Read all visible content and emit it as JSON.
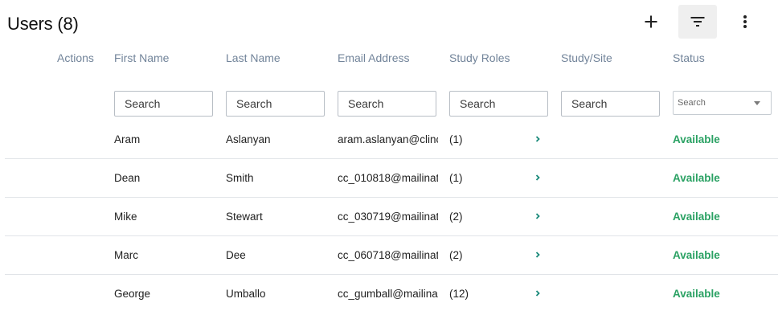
{
  "page": {
    "title": "Users (8)"
  },
  "toolbar": {
    "add_icon": "plus-icon",
    "filter_icon": "filter-list-icon",
    "more_icon": "more-vertical-icon"
  },
  "columns": {
    "actions": "Actions",
    "first_name": "First Name",
    "last_name": "Last Name",
    "email": "Email Address",
    "study_roles": "Study Roles",
    "study_site": "Study/Site",
    "status": "Status"
  },
  "filters": {
    "first_name_placeholder": "Search",
    "last_name_placeholder": "Search",
    "email_placeholder": "Search",
    "study_roles_placeholder": "Search",
    "study_site_placeholder": "Search",
    "status_placeholder": "Search"
  },
  "rows": [
    {
      "first": "Aram",
      "last": "Aslanyan",
      "email": "aram.aslanyan@clinc",
      "roles": "(1)",
      "status": "Available"
    },
    {
      "first": "Dean",
      "last": "Smith",
      "email": "cc_010818@mailinat",
      "roles": "(1)",
      "status": "Available"
    },
    {
      "first": "Mike",
      "last": "Stewart",
      "email": "cc_030719@mailinat",
      "roles": "(2)",
      "status": "Available"
    },
    {
      "first": "Marc",
      "last": "Dee",
      "email": "cc_060718@mailinat",
      "roles": "(2)",
      "status": "Available"
    },
    {
      "first": "George",
      "last": "Umballo",
      "email": "cc_gumball@mailina",
      "roles": "(12)",
      "status": "Available"
    }
  ],
  "colors": {
    "status_available": "#2aa163",
    "header_text": "#72849a",
    "chevron": "#1a8a7a"
  }
}
